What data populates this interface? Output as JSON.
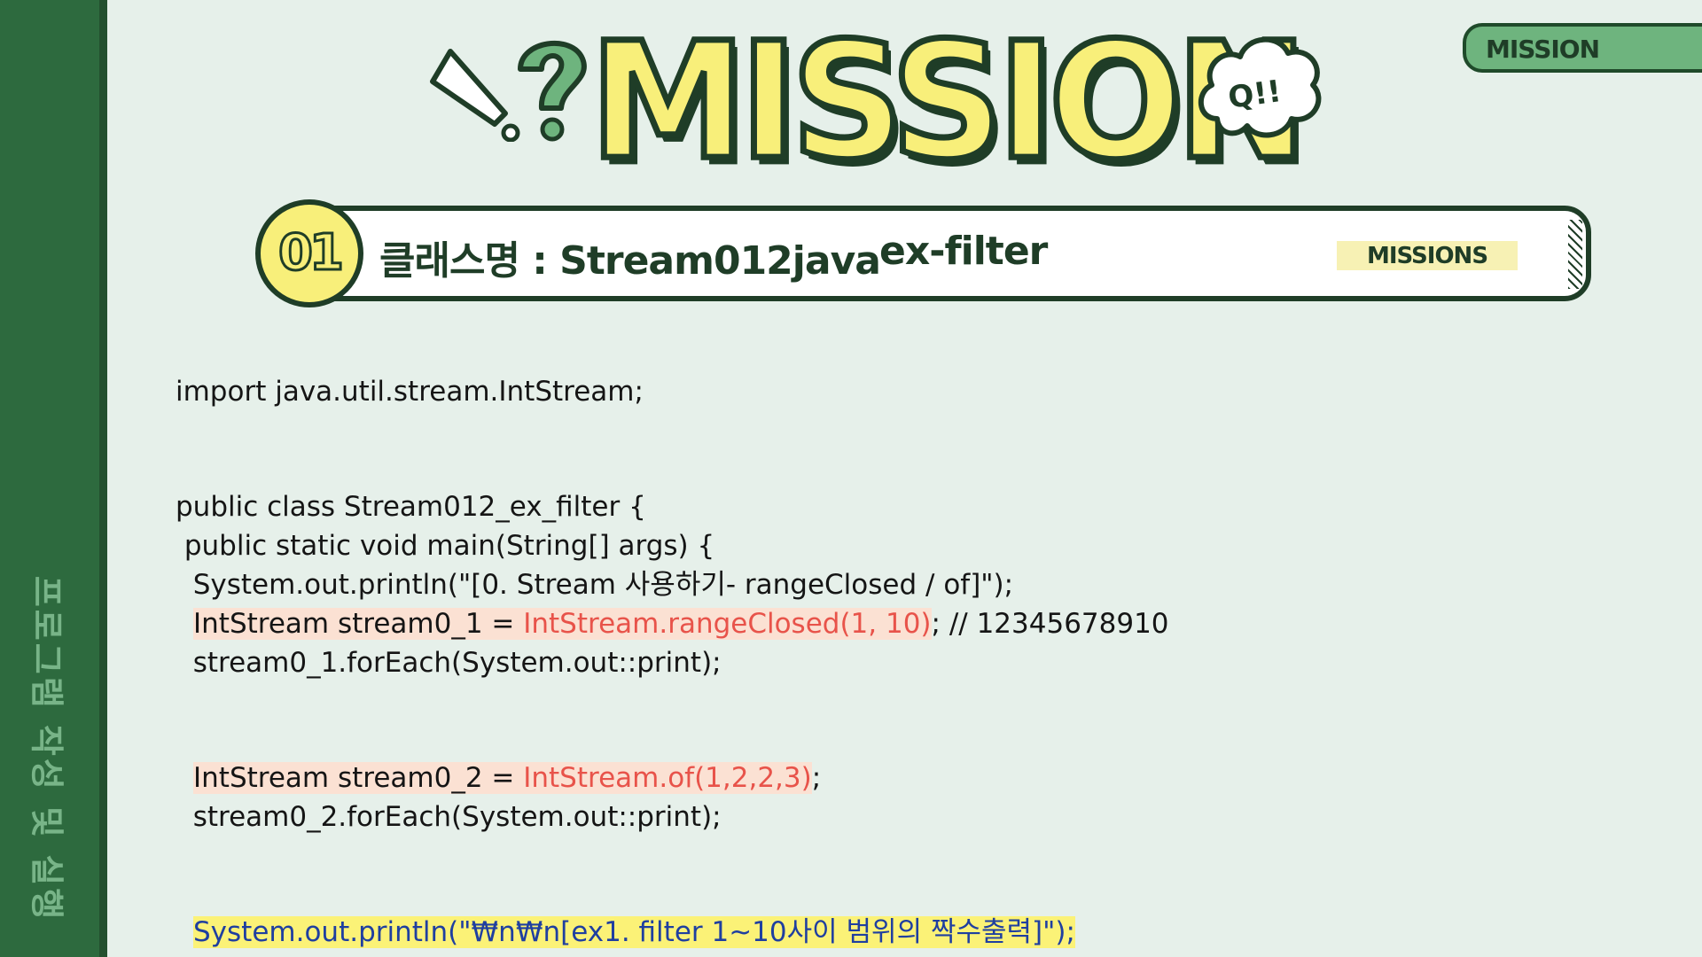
{
  "sidebar": {
    "label": "프로그램 작성 및 실행"
  },
  "corner_tab": {
    "label": "MISSION"
  },
  "header": {
    "title": "MISSION",
    "bubble_text": "Q!!",
    "badge_number": "01",
    "class_name": "클래스명 : Stream012java",
    "class_tag": "ex-filter",
    "missions_label": "MISSIONS"
  },
  "code": {
    "import_line": "import java.util.stream.IntStream;",
    "class_decl": "public class Stream012_ex_filter {",
    "main_decl": " public static void main(String[] args) {",
    "print_header": "  System.out.println(\"[0. Stream 사용하기- rangeClosed / of]\");",
    "stream1_prefix": "IntStream stream0_1 = ",
    "stream1_call": "IntStream.rangeClosed(1, 10)",
    "stream1_suffix": "; // 12345678910",
    "stream1_foreach": "  stream0_1.forEach(System.out::print);",
    "stream2_prefix": "IntStream stream0_2 = ",
    "stream2_call": "IntStream.of(1,2,2,3)",
    "stream2_suffix": ";",
    "stream2_foreach": "  stream0_2.forEach(System.out::print);",
    "print_ex1": "System.out.println(\"₩n₩n[ex1. filter 1~10사이 범위의 짝수출력]\");"
  },
  "colors": {
    "sidebar": "#2d6a3e",
    "background": "#e6f0ea",
    "title_fill": "#f8ef7a",
    "outline": "#1f3d27",
    "highlight_pink": "#fbe1d3",
    "code_red": "#e8534a",
    "highlight_yellow": "#fbf277",
    "code_blue": "#1f3fa0"
  }
}
